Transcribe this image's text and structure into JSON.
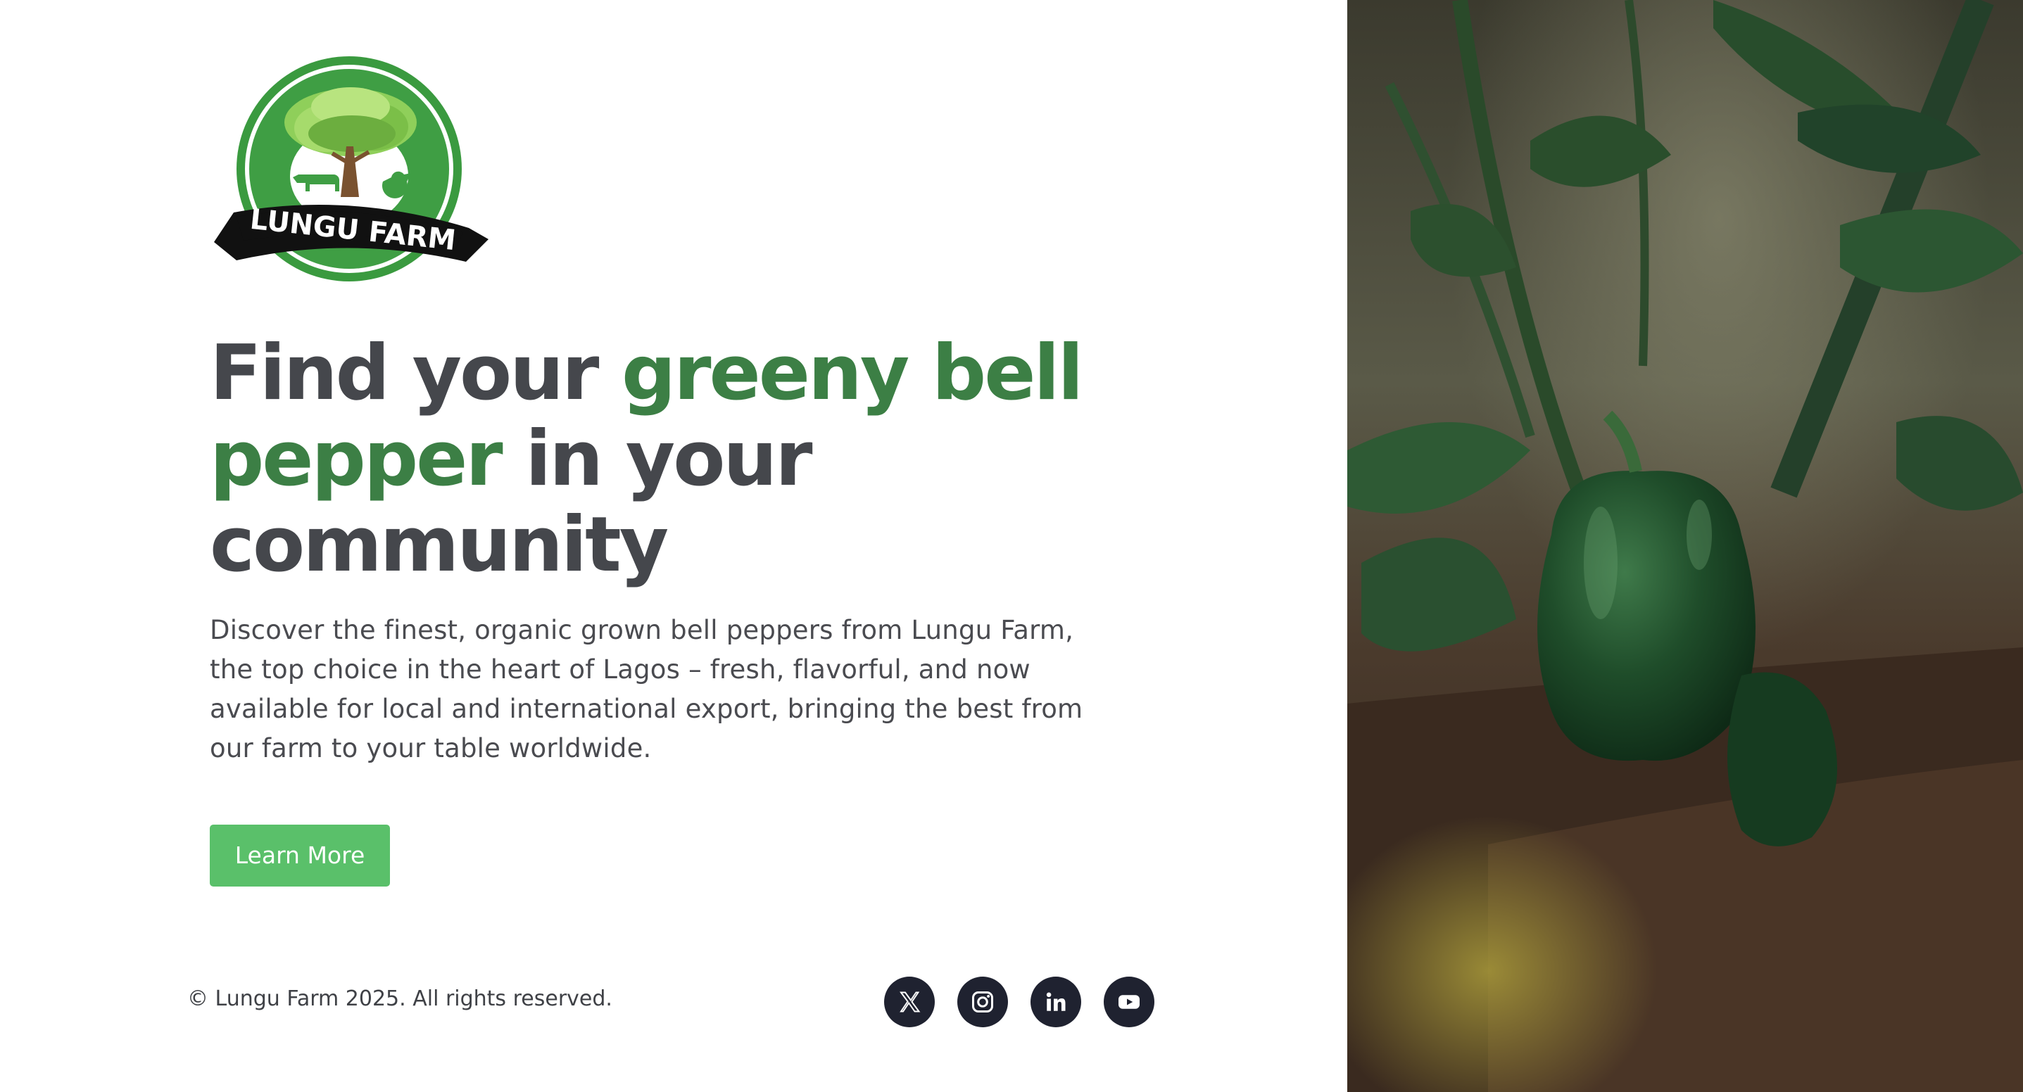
{
  "brand": {
    "logo_text": "LUNGU FARM"
  },
  "hero": {
    "headline_part1": "Find your ",
    "headline_accent": "greeny bell pepper",
    "headline_part2": " in your community",
    "description": "Discover the finest, organic grown bell peppers from Lungu Farm, the top choice in the heart of Lagos – fresh, flavorful, and now available for local and international export, bringing the best from our farm to your table worldwide.",
    "cta_label": "Learn More"
  },
  "footer": {
    "copyright": "© Lungu Farm 2025. All rights reserved.",
    "socials": [
      {
        "icon": "x-icon"
      },
      {
        "icon": "instagram-icon"
      },
      {
        "icon": "linkedin-icon"
      },
      {
        "icon": "youtube-icon"
      }
    ]
  },
  "colors": {
    "heading": "#45474c",
    "accent": "#3c7f45",
    "button": "#5ac06a",
    "social_bg": "#1f2230"
  }
}
